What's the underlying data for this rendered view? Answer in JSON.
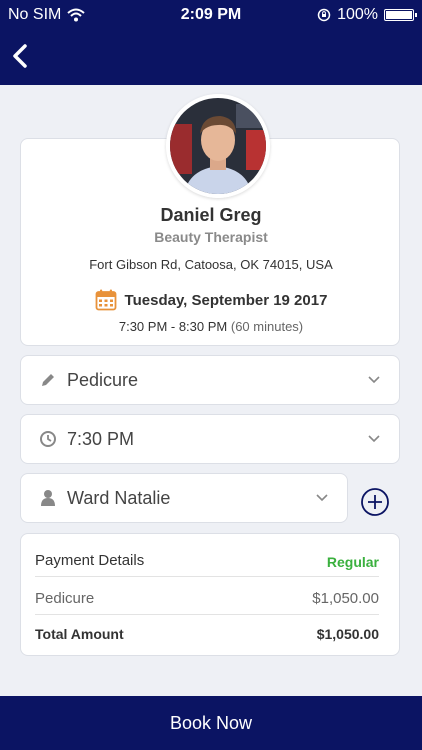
{
  "status_bar": {
    "carrier": "No SIM",
    "time": "2:09 PM",
    "battery": "100%"
  },
  "navigation": {
    "back_icon": "chevron-left-icon"
  },
  "profile": {
    "name": "Daniel Greg",
    "role": "Beauty Therapist",
    "address": "Fort Gibson Rd, Catoosa, OK 74015, USA",
    "date": "Tuesday, September 19 2017",
    "time_range": "7:30 PM - 8:30 PM",
    "duration": "(60 minutes)"
  },
  "fields": {
    "service": {
      "value": "Pedicure",
      "icon": "pencil-icon"
    },
    "time": {
      "value": "7:30 PM",
      "icon": "clock-icon"
    },
    "staff": {
      "value": "Ward Natalie",
      "icon": "person-icon"
    }
  },
  "payment": {
    "title": "Payment Details",
    "type": "Regular",
    "items": [
      {
        "label": "Pedicure",
        "amount": "$1,050.00"
      }
    ],
    "total_label": "Total Amount",
    "total_amount": "$1,050.00"
  },
  "book_button": "Book Now",
  "colors": {
    "header": "#0b1463",
    "accent": "#3ab03e",
    "calendar": "#e8923a",
    "background": "#eef0f5"
  }
}
